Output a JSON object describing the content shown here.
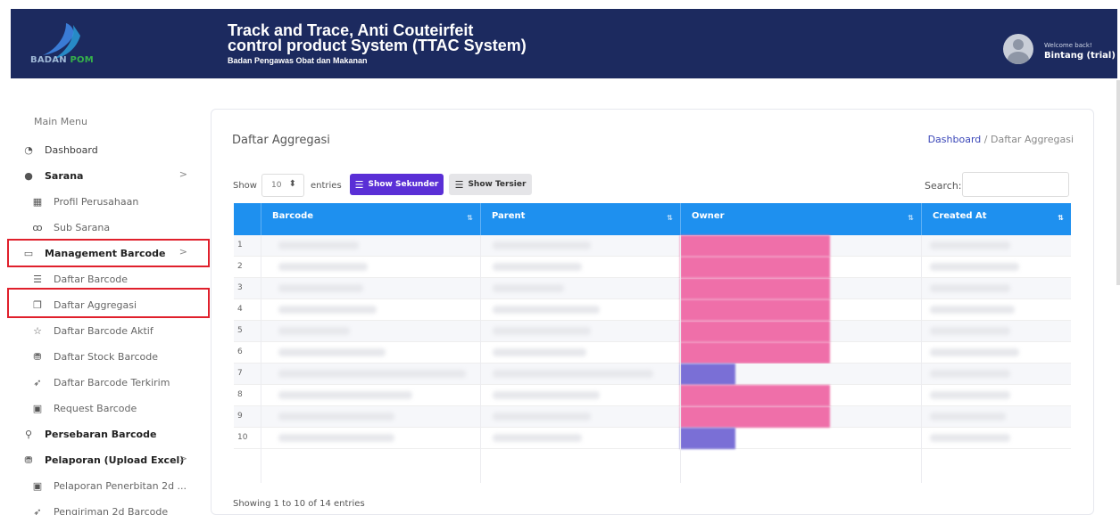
{
  "header": {
    "logo_text": "BADAN",
    "logo_text2": "POM",
    "title_line1": "Track and Trace, Anti Couteirfeit",
    "title_line2": "control product System (TTAC System)",
    "subtitle": "Badan Pengawas Obat dan Makanan",
    "welcome": "Welcome back!",
    "username": "Bintang (trial)"
  },
  "sidebar": {
    "title": "Main Menu",
    "items": [
      {
        "label": "Dashboard",
        "icon": "gauge-icon"
      },
      {
        "label": "Sarana",
        "icon": "user-group-icon",
        "chevron": ">"
      },
      {
        "label": "Profil Perusahaan",
        "icon": "building-icon"
      },
      {
        "label": "Sub Sarana",
        "icon": "people-icon"
      },
      {
        "label": "Management Barcode",
        "icon": "window-icon",
        "chevron": ">"
      },
      {
        "label": "Daftar Barcode",
        "icon": "list-icon"
      },
      {
        "label": "Daftar Aggregasi",
        "icon": "stack-icon"
      },
      {
        "label": "Daftar Barcode Aktif",
        "icon": "star-icon"
      },
      {
        "label": "Daftar Stock Barcode",
        "icon": "box-icon"
      },
      {
        "label": "Daftar Barcode Terkirim",
        "icon": "send-icon"
      },
      {
        "label": "Request Barcode",
        "icon": "monitor-icon"
      },
      {
        "label": "Persebaran Barcode",
        "icon": "location-icon"
      },
      {
        "label": "Pelaporan (Upload Excel)",
        "icon": "box-icon",
        "chevron": ">"
      },
      {
        "label": "Pelaporan Penerbitan 2d ...",
        "icon": "monitor-icon"
      },
      {
        "label": "Pengiriman 2d Barcode",
        "icon": "send-icon"
      }
    ]
  },
  "main": {
    "title": "Daftar Aggregasi",
    "breadcrumb_link": "Dashboard",
    "breadcrumb_sep": "/",
    "breadcrumb_current": "Daftar Aggregasi",
    "show_label": "Show",
    "page_length": "10",
    "entries_label": "entries",
    "btn_sekunder": "Show Sekunder",
    "btn_tersier": "Show Tersier",
    "search_label": "Search:",
    "search_value": "",
    "columns": [
      "Barcode",
      "Parent",
      "Owner",
      "Created At"
    ],
    "rows": [
      "1",
      "2",
      "3",
      "4",
      "5",
      "6",
      "7",
      "8",
      "9",
      "10"
    ],
    "footer": "Showing 1 to 10 of 14 entries"
  },
  "colors": {
    "header_bg": "#1c2a5f",
    "table_head": "#1e90ef",
    "primary_button": "#5a2fd6",
    "owner_pink": "#ef6fa9",
    "owner_purple": "#7a6fd6",
    "highlight": "#e0202c"
  }
}
